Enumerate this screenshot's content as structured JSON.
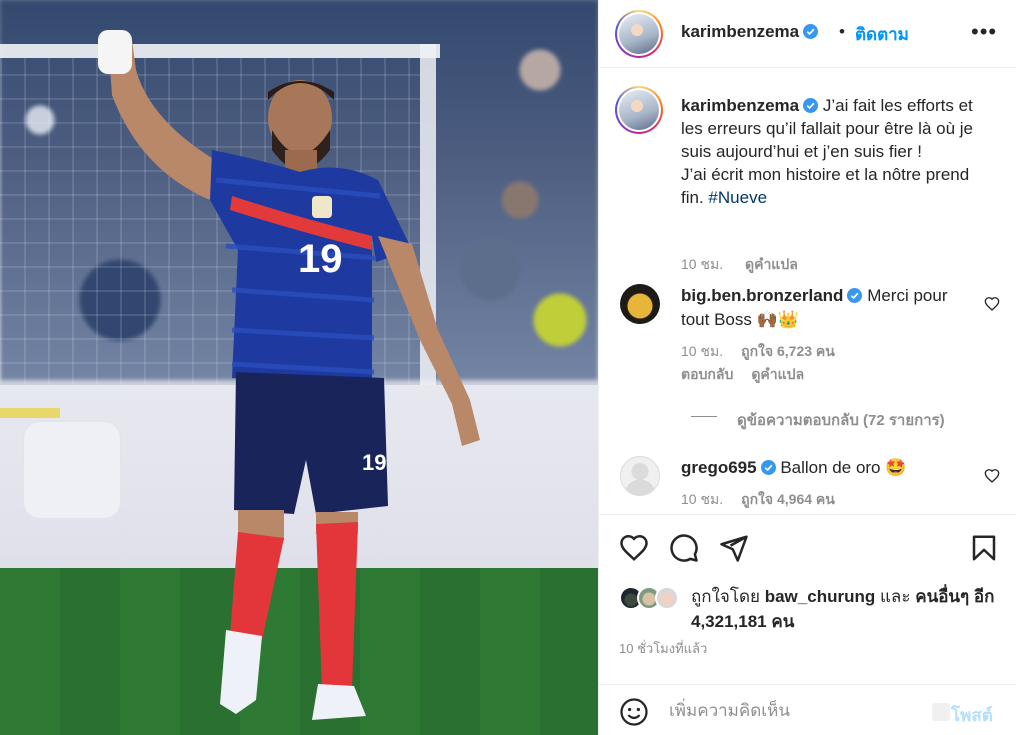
{
  "post": {
    "username": "karimbenzema",
    "follow_label": "ติดตาม",
    "more_icon": "more-options-icon",
    "image": {
      "jersey_number": "19"
    },
    "caption": {
      "username": "karimbenzema",
      "text": "J’ai fait les efforts et les erreurs qu’il fallait pour être là où je suis aujourd’hui et j’en suis fier !\nJ’ai écrit mon histoire et la nôtre prend fin.",
      "hashtag": "#Nueve",
      "time": "10 ชม.",
      "translate_label": "ดูคำแปล"
    },
    "comments": [
      {
        "username": "big.ben.bronzerland",
        "text": "Merci pour tout Boss 🙌🏾👑",
        "time": "10 ชม.",
        "likes": "ถูกใจ 6,723 คน",
        "reply_label": "ตอบกลับ",
        "translate_label": "ดูคำแปล",
        "view_replies": "ดูข้อความตอบกลับ (72 รายการ)"
      },
      {
        "username": "grego695",
        "text": "Ballon de oro 🤩",
        "time": "10 ชม.",
        "likes": "ถูกใจ 4,964 คน"
      }
    ],
    "liked_by": {
      "prefix": "ถูกใจโดย",
      "user": "baw_churung",
      "and": "และ",
      "others_prefix": "คนอื่นๆ อีก",
      "count": "4,321,181",
      "suffix": "คน"
    },
    "time_ago": "10 ชั่วโมงที่แล้ว",
    "comment_box": {
      "placeholder": "เพิ่มความคิดเห็น",
      "post_label": "โพสต์"
    }
  },
  "colors": {
    "accent_blue": "#0095f6",
    "verified_blue": "#3897f0",
    "hashtag": "#00376b",
    "muted_text": "#8e8e8e",
    "post_disabled": "#b2dffc"
  }
}
